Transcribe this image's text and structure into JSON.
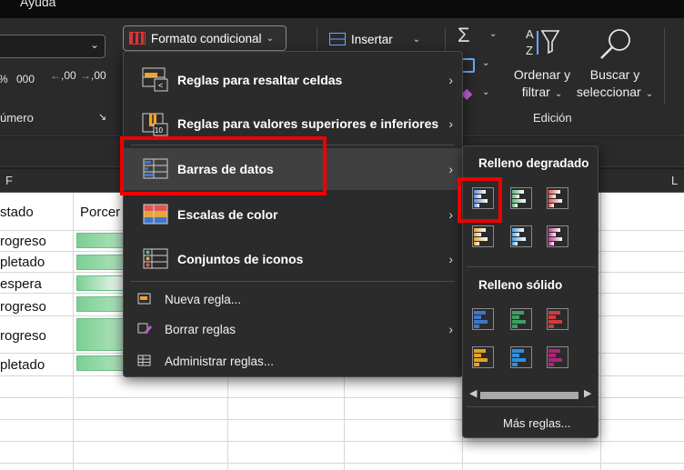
{
  "menu": {
    "help": "Ayuda"
  },
  "ribbon": {
    "number_group_label": "úmero",
    "number_icons": {
      "percent": "%",
      "thousands": "000",
      "inc_decimals": ",00",
      "dec_decimals": ",00"
    },
    "conditional_format_label": "Formato condicional",
    "insert_label": "Insertar",
    "sort_filter_label": [
      "Ordenar y",
      "filtrar"
    ],
    "find_select_label": [
      "Buscar y",
      "seleccionar"
    ],
    "editing_group_label": "Edición",
    "sigma": "Σ"
  },
  "sheet": {
    "columns": {
      "f": "F",
      "l": "L"
    },
    "header_cells": [
      "stado",
      "Porcer"
    ],
    "rows": [
      "rogreso",
      "pletado",
      "espera",
      "rogreso",
      "rogreso",
      "pletado"
    ],
    "bar_fill": [
      0.9,
      0.9,
      0.4,
      0.9,
      0.9,
      0.9
    ]
  },
  "cf_menu": {
    "items": [
      {
        "label": "Reglas para resaltar celdas"
      },
      {
        "label": "Reglas para valores superiores e inferiores"
      },
      {
        "label": "Barras de datos"
      },
      {
        "label": "Escalas de color"
      },
      {
        "label": "Conjuntos de iconos"
      }
    ],
    "small_items": [
      {
        "label": "Nueva regla..."
      },
      {
        "label": "Borrar reglas"
      },
      {
        "label": "Administrar reglas..."
      }
    ]
  },
  "databars_menu": {
    "gradient_heading": "Relleno degradado",
    "solid_heading": "Relleno sólido",
    "more_rules": "Más reglas...",
    "gradient_colors": [
      "#5b8fd6",
      "#63b57c",
      "#e05555",
      "#e9a53b",
      "#4fa3e6",
      "#c03f8f"
    ],
    "solid_colors": [
      "#3f78c8",
      "#3da05e",
      "#d23c3c",
      "#e6a12a",
      "#2f8fdf",
      "#b0237c"
    ]
  },
  "colors": {
    "highlight_red": "#ee0000",
    "menu_bg": "#2b2b2b"
  }
}
